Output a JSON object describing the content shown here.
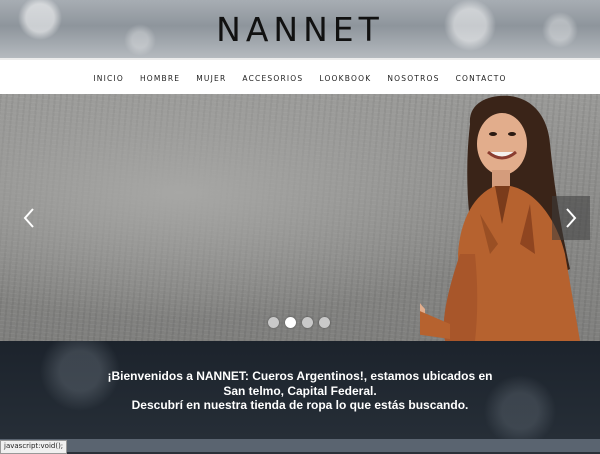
{
  "header": {
    "logo": "NANNET"
  },
  "nav": {
    "items": [
      "INICIO",
      "HOMBRE",
      "MUJER",
      "ACCESORIOS",
      "LOOKBOOK",
      "NOSOTROS",
      "CONTACTO"
    ]
  },
  "slider": {
    "prev_icon": "chevron-left-icon",
    "next_icon": "chevron-right-icon",
    "slide_count": 4,
    "active_slide": 2
  },
  "welcome": {
    "line1": "¡Bienvenidos a NANNET: Cueros Argentinos!, estamos ubicados en",
    "line2": "San telmo, Capital Federal.",
    "line3": "Descubrí en nuestra tienda de ropa lo que estás buscando."
  },
  "status_bar": {
    "text": "javascript:void();"
  },
  "colors": {
    "welcome_bg": "#1c232c",
    "nav_bg": "#ffffff",
    "logo": "#111111"
  }
}
